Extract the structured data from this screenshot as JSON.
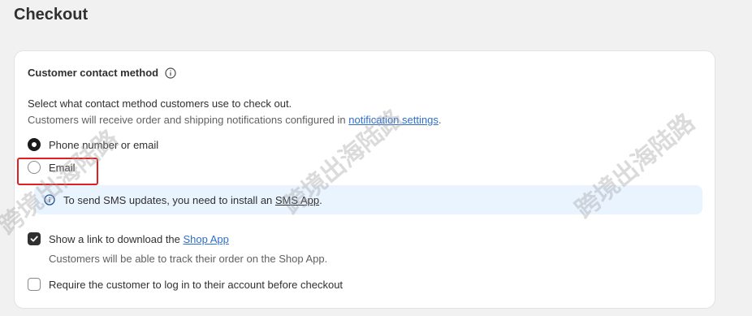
{
  "page": {
    "title": "Checkout"
  },
  "contact_method": {
    "heading": "Customer contact method",
    "description": "Select what contact method customers use to check out.",
    "notification_prefix": "Customers will receive order and shipping notifications configured in ",
    "notification_link": "notification settings",
    "notification_suffix": ".",
    "options": [
      {
        "label": "Phone number or email",
        "selected": true
      },
      {
        "label": "Email",
        "selected": false
      }
    ],
    "banner": {
      "prefix": "To send SMS updates, you need to install an ",
      "link": "SMS App",
      "suffix": "."
    }
  },
  "shop_app": {
    "label_prefix": "Show a link to download the ",
    "link": "Shop App",
    "checked": true,
    "help": "Customers will be able to track their order on the Shop App."
  },
  "require_login": {
    "label": "Require the customer to log in to their account before checkout",
    "checked": false
  },
  "watermark": {
    "text": "跨境出海陆路"
  },
  "colors": {
    "accent_link": "#2c6ecb",
    "banner_bg": "#eaf4ff",
    "highlight_border": "#e02020"
  }
}
